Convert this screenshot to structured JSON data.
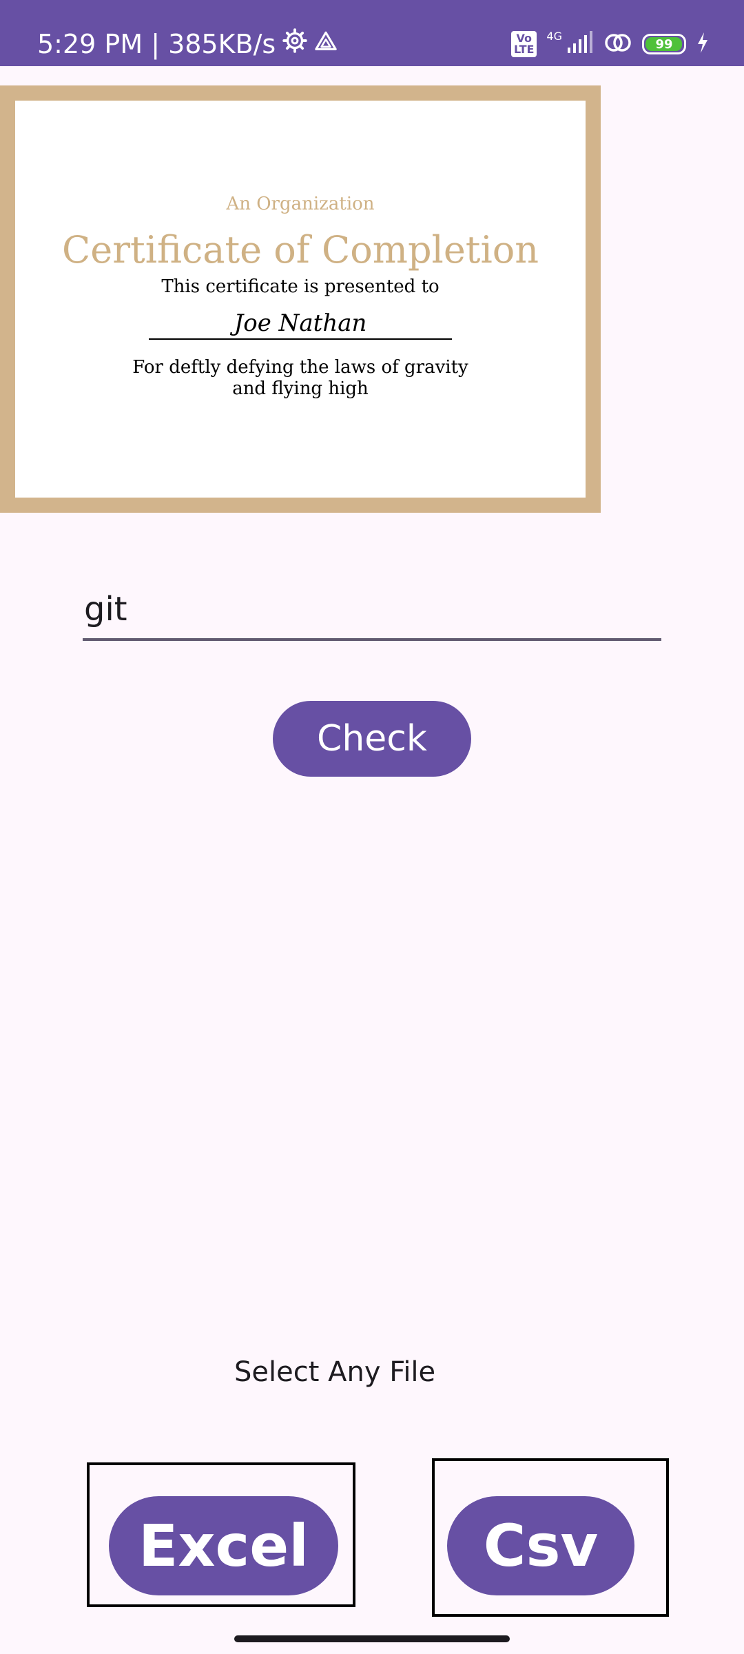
{
  "status_bar": {
    "time_speed": "5:29 PM | 385KB/s",
    "network": "4G",
    "battery": "99",
    "battery_level": 0.99,
    "volte": "Vo\nLTE",
    "background": "#6750a4"
  },
  "certificate": {
    "organization": "An Organization",
    "title": "Certificate of Completion",
    "presented_to": "This certificate is presented to",
    "recipient_name": "Joe Nathan",
    "reason": "For deftly defying the laws of gravity and flying high",
    "border_color": "#d2b48c",
    "accent_color": "#cfb184"
  },
  "input": {
    "value": "git"
  },
  "buttons": {
    "check_label": "Check",
    "excel_label": "Excel",
    "csv_label": "Csv",
    "color": "#6750a4"
  },
  "file_section": {
    "label": "Select Any File"
  },
  "icons": {
    "settings": "gear-icon",
    "drive": "drive-icon",
    "signal": "signal-icon",
    "hotspot": "link-icon",
    "charging": "bolt-icon"
  }
}
